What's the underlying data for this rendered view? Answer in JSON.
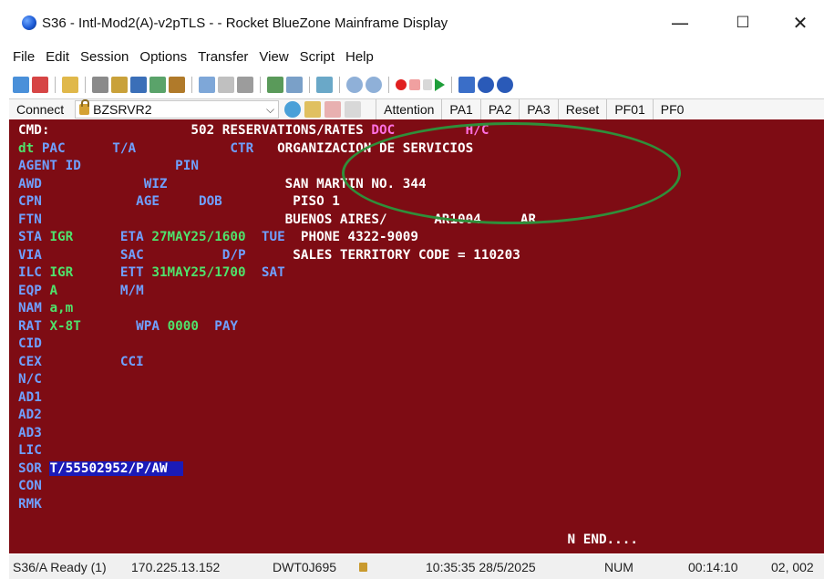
{
  "window": {
    "title": "S36 - Intl-Mod2(A)-v2pTLS -  - Rocket BlueZone Mainframe Display",
    "minimize": "—",
    "maximize": "☐",
    "close": "✕"
  },
  "menu": [
    "File",
    "Edit",
    "Session",
    "Options",
    "Transfer",
    "View",
    "Script",
    "Help"
  ],
  "connect_bar": {
    "connect_label": "Connect",
    "server": "BZSRVR2",
    "keys": [
      "Attention",
      "PA1",
      "PA2",
      "PA3",
      "Reset",
      "PF01",
      "PF0"
    ]
  },
  "terminal": {
    "lines": [
      {
        "segments": [
          {
            "t": "CMD:                  ",
            "c": "cw"
          },
          {
            "t": "502 RESERVATIONS/RATES ",
            "c": "cw"
          },
          {
            "t": "DOC",
            "c": "cp"
          },
          {
            "t": "         ",
            "c": "cw"
          },
          {
            "t": "H/C",
            "c": "cp"
          }
        ]
      },
      {
        "segments": [
          {
            "t": "dt ",
            "c": "cg"
          },
          {
            "t": "PAC      T/A            CTR   ",
            "c": "cb"
          },
          {
            "t": "ORGANIZACION DE SERVICIOS",
            "c": "cw"
          }
        ]
      },
      {
        "segments": [
          {
            "t": "AGENT ID            PIN",
            "c": "cb"
          }
        ]
      },
      {
        "segments": [
          {
            "t": "AWD             WIZ               ",
            "c": "cb"
          },
          {
            "t": "SAN MARTIN NO. 344",
            "c": "cw"
          }
        ]
      },
      {
        "segments": [
          {
            "t": "CPN            AGE     DOB         ",
            "c": "cb"
          },
          {
            "t": "PISO 1",
            "c": "cw"
          }
        ]
      },
      {
        "segments": [
          {
            "t": "FTN                               ",
            "c": "cb"
          },
          {
            "t": "BUENOS AIRES/      AR1004     AR",
            "c": "cw"
          }
        ]
      },
      {
        "segments": [
          {
            "t": "STA ",
            "c": "cb"
          },
          {
            "t": "IGR      ",
            "c": "cg"
          },
          {
            "t": "ETA ",
            "c": "cb"
          },
          {
            "t": "27MAY25/1600  ",
            "c": "cg"
          },
          {
            "t": "TUE  ",
            "c": "cb"
          },
          {
            "t": "PHONE 4322-9009",
            "c": "cw"
          }
        ]
      },
      {
        "segments": [
          {
            "t": "VIA          SAC          D/P      ",
            "c": "cb"
          },
          {
            "t": "SALES TERRITORY CODE = 110203",
            "c": "cw"
          }
        ]
      },
      {
        "segments": [
          {
            "t": "ILC ",
            "c": "cb"
          },
          {
            "t": "IGR      ",
            "c": "cg"
          },
          {
            "t": "ETT ",
            "c": "cb"
          },
          {
            "t": "31MAY25/1700  ",
            "c": "cg"
          },
          {
            "t": "SAT",
            "c": "cb"
          }
        ]
      },
      {
        "segments": [
          {
            "t": "EQP ",
            "c": "cb"
          },
          {
            "t": "A        ",
            "c": "cg"
          },
          {
            "t": "M/M",
            "c": "cb"
          }
        ]
      },
      {
        "segments": [
          {
            "t": "NAM ",
            "c": "cb"
          },
          {
            "t": "a,m",
            "c": "cg"
          }
        ]
      },
      {
        "segments": [
          {
            "t": "RAT ",
            "c": "cb"
          },
          {
            "t": "X-8T       ",
            "c": "cg"
          },
          {
            "t": "WPA ",
            "c": "cb"
          },
          {
            "t": "0000  ",
            "c": "cg"
          },
          {
            "t": "PAY",
            "c": "cb"
          }
        ]
      },
      {
        "segments": [
          {
            "t": "CID",
            "c": "cb"
          }
        ]
      },
      {
        "segments": [
          {
            "t": "CEX          CCI",
            "c": "cb"
          }
        ]
      },
      {
        "segments": [
          {
            "t": "N/C",
            "c": "cb"
          }
        ]
      },
      {
        "segments": [
          {
            "t": "AD1",
            "c": "cb"
          }
        ]
      },
      {
        "segments": [
          {
            "t": "AD2",
            "c": "cb"
          }
        ]
      },
      {
        "segments": [
          {
            "t": "AD3",
            "c": "cb"
          }
        ]
      },
      {
        "segments": [
          {
            "t": "LIC",
            "c": "cb"
          }
        ]
      },
      {
        "segments": [
          {
            "t": "SOR ",
            "c": "cb"
          },
          {
            "t": "T/55502952/P/AW  ",
            "c": "hl"
          }
        ]
      },
      {
        "segments": [
          {
            "t": "CON",
            "c": "cb"
          }
        ]
      },
      {
        "segments": [
          {
            "t": "RMK",
            "c": "cb"
          }
        ]
      },
      {
        "segments": [
          {
            "t": "                                                                     ",
            "c": "cw"
          }
        ]
      },
      {
        "segments": [
          {
            "t": "                                                                      N END....",
            "c": "cw"
          }
        ]
      }
    ]
  },
  "status_bar": {
    "session": "S36/A Ready (1)",
    "ip": "170.225.13.152",
    "device": "DWT0J695",
    "datetime": "10:35:35 28/5/2025",
    "num": "NUM",
    "elapsed": "00:14:10",
    "cursor": "02, 002"
  }
}
